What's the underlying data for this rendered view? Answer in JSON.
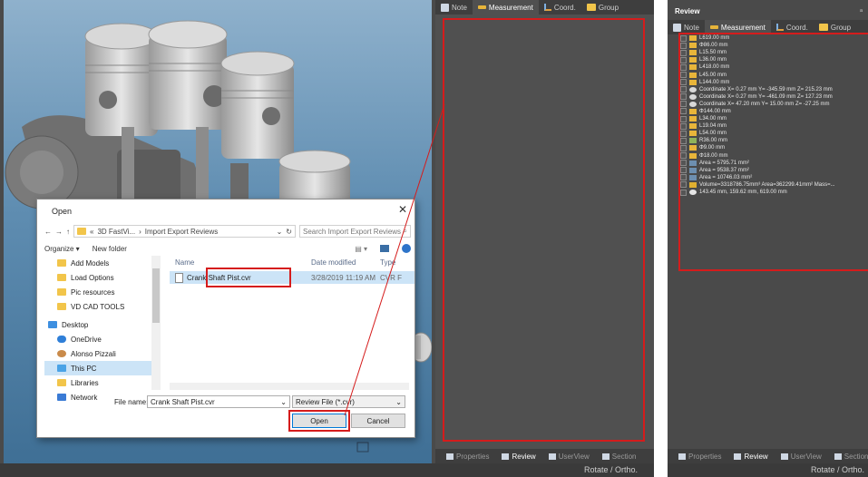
{
  "left_panel": {
    "tabs": [
      {
        "label": "Note",
        "icon": "note-icon"
      },
      {
        "label": "Measurement",
        "icon": "ruler-icon"
      },
      {
        "label": "Coord.",
        "icon": "axis-icon"
      },
      {
        "label": "Group",
        "icon": "folder-icon"
      }
    ],
    "bottom_tabs": [
      "Properties",
      "Review",
      "UserView",
      "Section"
    ],
    "status": "Rotate / Ortho."
  },
  "dialog": {
    "title": "Open",
    "close": "✕",
    "address": {
      "prefix": "«",
      "folder1": "3D FastVi...",
      "sep": "›",
      "folder2": "Import Export Reviews",
      "search_placeholder": "Search Import Export Reviews"
    },
    "organize": "Organize ▾",
    "new_folder": "New folder",
    "nav_items": [
      "Add Models",
      "Load Options",
      "Pic resources",
      "VD CAD TOOLS",
      "Desktop",
      "OneDrive",
      "Alonso Pizzali",
      "This PC",
      "Libraries",
      "Network"
    ],
    "columns": [
      "Name",
      "Date modified",
      "Type"
    ],
    "file": {
      "name": "Crank Shaft Pist.cvr",
      "date": "3/28/2019 11:19 AM",
      "type": "CVR F"
    },
    "file_name_label": "File name:",
    "file_name_value": "Crank Shaft Pist.cvr",
    "file_type": "Review File (*.cvr)",
    "open_label": "Open",
    "cancel_label": "Cancel"
  },
  "right_panel": {
    "title": "Review",
    "tabs": [
      "Note",
      "Measurement",
      "Coord.",
      "Group"
    ],
    "items": [
      "L619.00 mm",
      "Φ86.00 mm",
      "L15.50 mm",
      "L36.00 mm",
      "L418.00 mm",
      "L45.00 mm",
      "L144.00 mm",
      "Coordinate  X= 0.27 mm  Y= -345.59 mm  Z= 215.23 mm",
      "Coordinate  X= 0.27 mm  Y= -461.09 mm  Z= 127.23 mm",
      "Coordinate  X= 47.20 mm  Y= 15.00 mm  Z= -27.25 mm",
      "Φ144.00 mm",
      "L34.00 mm",
      "L19.04 mm",
      "L54.00 mm",
      "R36.00 mm",
      "Φ9.00 mm",
      "Φ18.00 mm",
      "Area = 5795.71 mm²",
      "Area = 9538.37 mm²",
      "Area = 10746.03 mm²",
      "Volume=3318786.75mm³  Area=362299.41mm²  Mass=...",
      "143.45 mm, 159.62 mm, 619.00 mm"
    ],
    "bottom_tabs": [
      "Properties",
      "Review",
      "UserView",
      "Section"
    ],
    "status": "Rotate / Ortho."
  }
}
